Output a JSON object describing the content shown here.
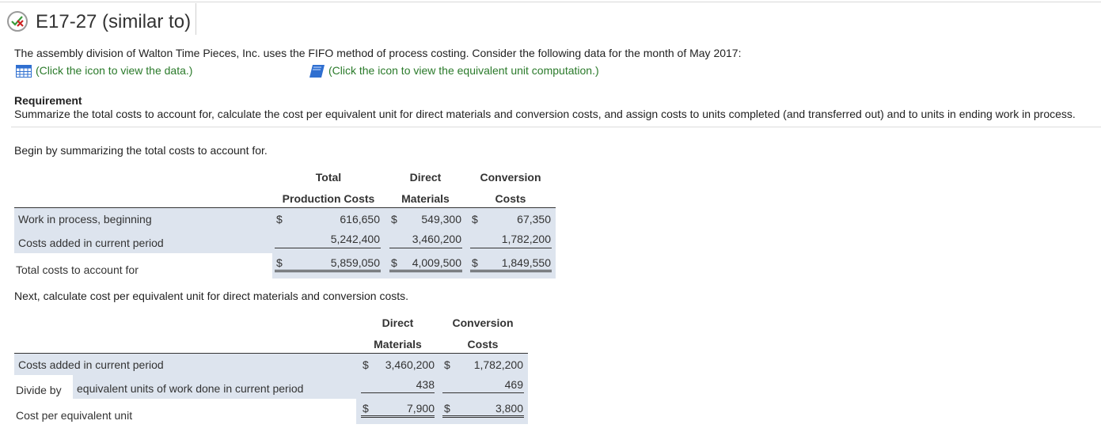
{
  "header": {
    "title": "E17-27 (similar to)",
    "status_icon": "partially-correct-icon"
  },
  "intro": {
    "text": "The assembly division of Walton Time Pieces, Inc. uses the FIFO method of process costing. Consider the following data for the month of May 2017:",
    "data_link": "(Click the icon to view the data.)",
    "data_icon": "table-grid-icon",
    "equiv_link": "(Click the icon to view the equivalent unit computation.)",
    "equiv_icon": "book-icon"
  },
  "requirement": {
    "title": "Requirement",
    "text": "Summarize the total costs to account for, calculate the cost per equivalent unit for direct materials and conversion costs, and assign costs to units completed (and transferred out) and to units in ending work in process."
  },
  "section1": {
    "prompt": "Begin by summarizing the total costs to account for.",
    "headers": {
      "total_line1": "Total",
      "total_line2": "Production Costs",
      "dm_line1": "Direct",
      "dm_line2": "Materials",
      "cc_line1": "Conversion",
      "cc_line2": "Costs"
    },
    "rows": [
      {
        "label": "Work in process, beginning",
        "total": "616,650",
        "dm": "549,300",
        "cc": "67,350"
      },
      {
        "label": "Costs added in current period",
        "total": "5,242,400",
        "dm": "3,460,200",
        "cc": "1,782,200"
      },
      {
        "label": "Total costs to account for",
        "total": "5,859,050",
        "dm": "4,009,500",
        "cc": "1,849,550"
      }
    ],
    "currency": "$"
  },
  "section2": {
    "prompt": "Next, calculate cost per equivalent unit for direct materials and conversion costs.",
    "headers": {
      "dm_line1": "Direct",
      "dm_line2": "Materials",
      "cc_line1": "Conversion",
      "cc_line2": "Costs"
    },
    "rows": [
      {
        "label": "Costs added in current period",
        "dm": "3,460,200",
        "cc": "1,782,200"
      },
      {
        "label": "Divide by",
        "sublabel": "equivalent units of work done in current period",
        "dm": "438",
        "cc": "469"
      },
      {
        "label": "Cost per equivalent unit",
        "dm": "7,900",
        "cc": "3,800"
      }
    ],
    "currency": "$"
  },
  "colors": {
    "link": "#2a7a2a",
    "row_shade": "#dde4ee",
    "icon_blue": "#2f6fd0",
    "icon_red": "#cc2222",
    "icon_green": "#3a9a3a"
  }
}
